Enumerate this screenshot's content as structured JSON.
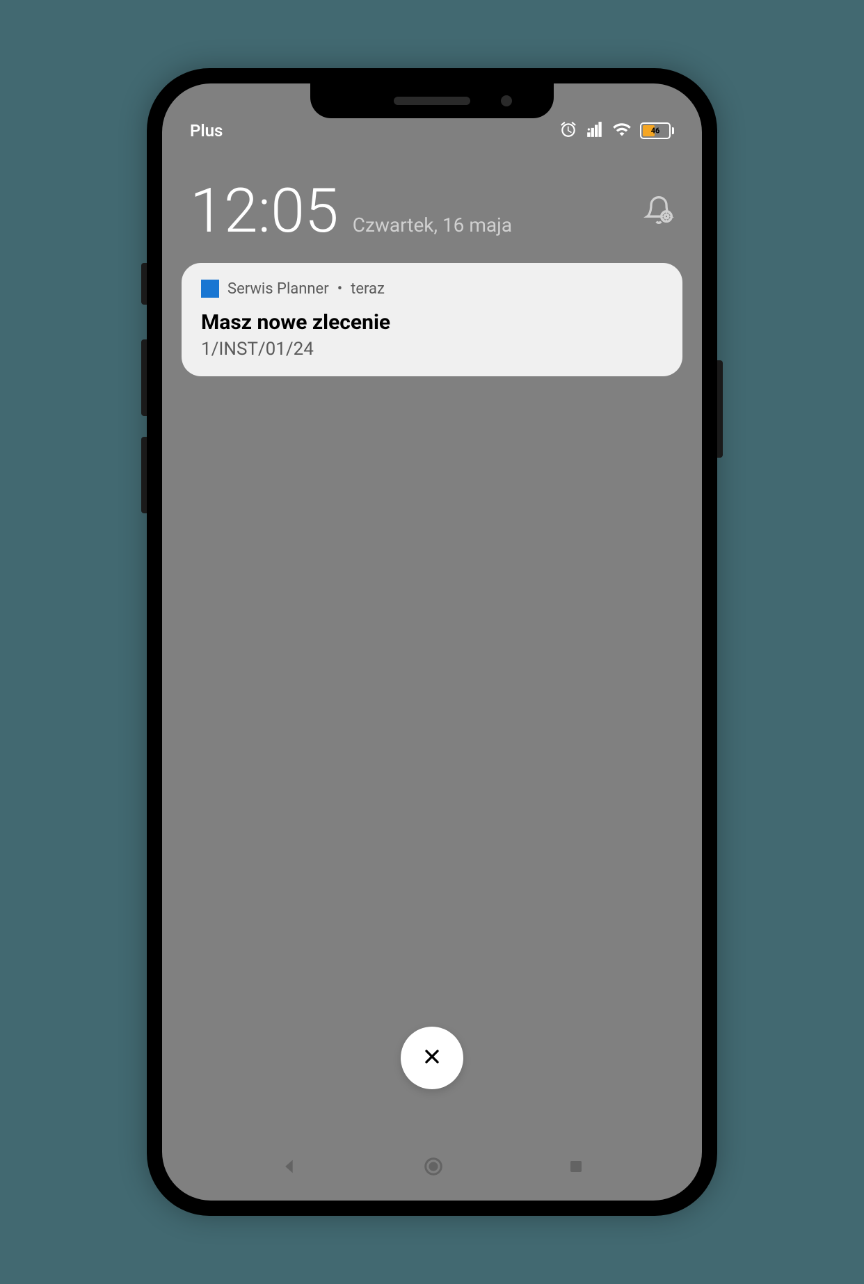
{
  "status_bar": {
    "carrier": "Plus",
    "battery_level": "46"
  },
  "clock": {
    "time": "12:05",
    "date": "Czwartek, 16 maja"
  },
  "notification": {
    "app_name": "Serwis Planner",
    "separator": "•",
    "time": "teraz",
    "title": "Masz nowe zlecenie",
    "body": "1/INST/01/24"
  }
}
